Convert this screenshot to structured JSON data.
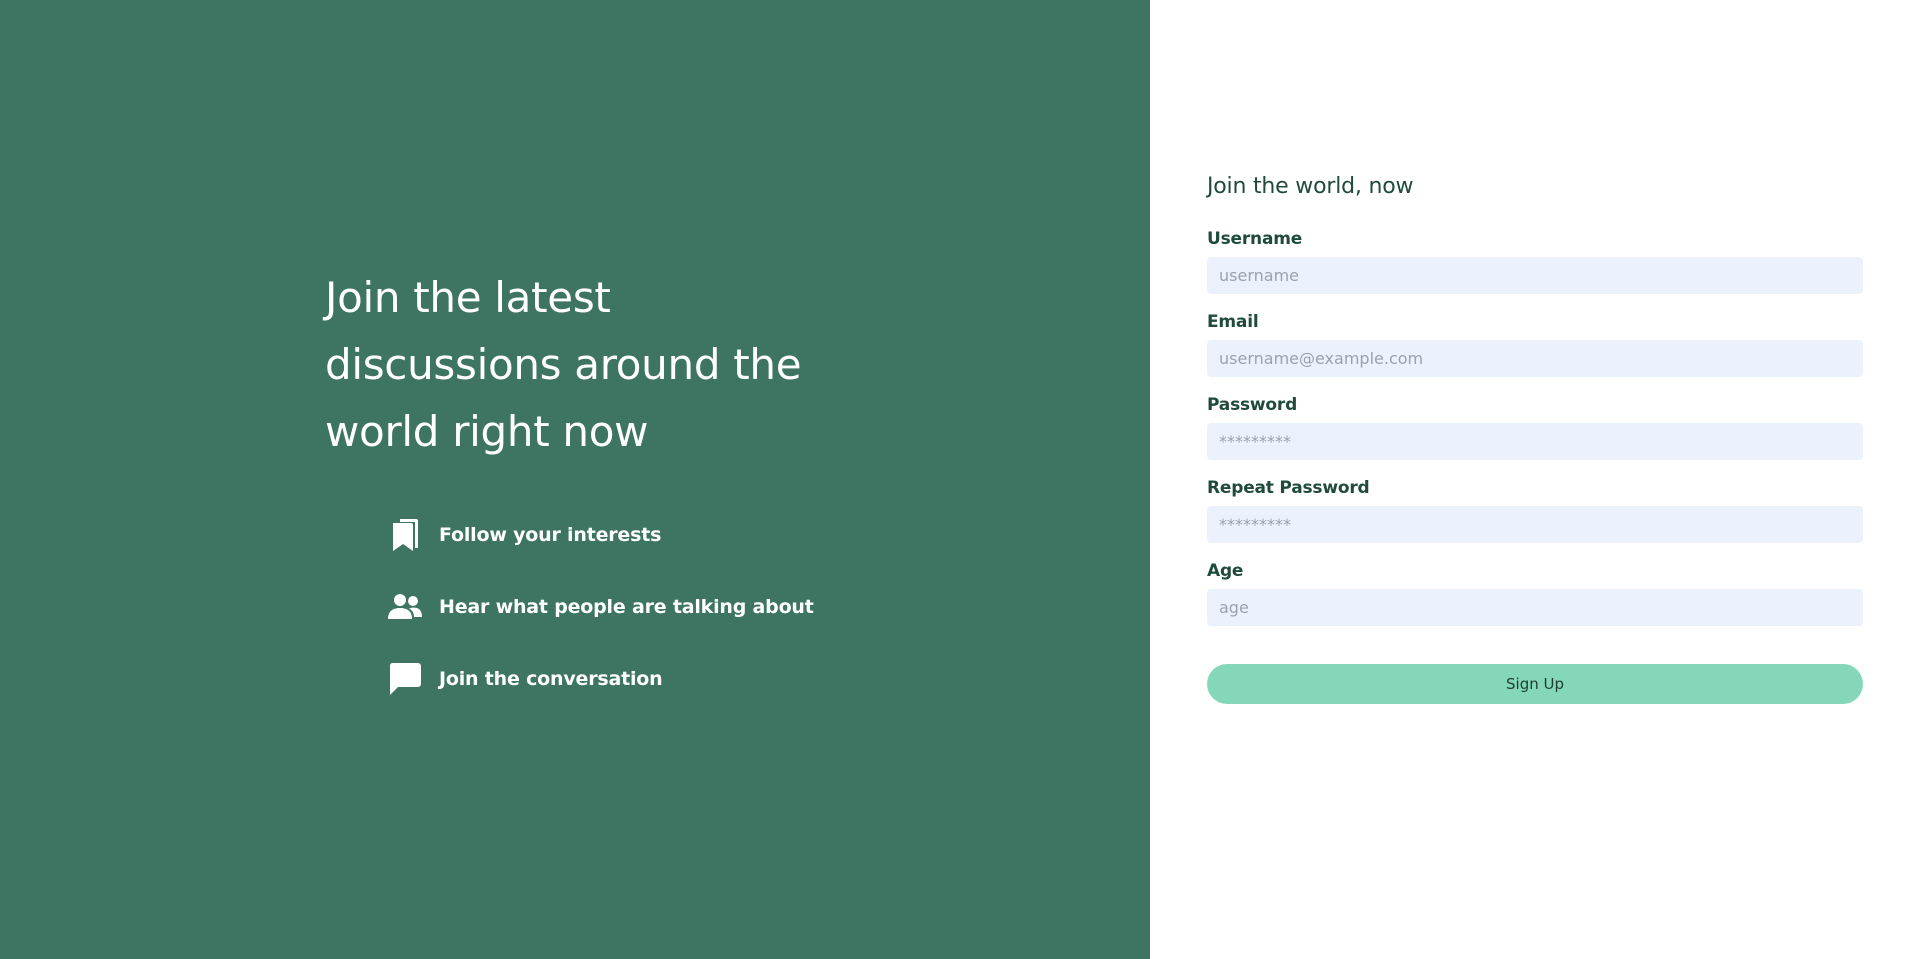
{
  "hero": {
    "title": "Join the latest discussions around the world right now",
    "features": [
      {
        "icon": "bookmark-icon",
        "label": "Follow your interests"
      },
      {
        "icon": "people-icon",
        "label": "Hear what people are talking about"
      },
      {
        "icon": "chat-bubble-icon",
        "label": "Join the conversation"
      }
    ]
  },
  "form": {
    "title": "Join the world, now",
    "fields": {
      "username": {
        "label": "Username",
        "placeholder": "username",
        "value": ""
      },
      "email": {
        "label": "Email",
        "placeholder": "username@example.com",
        "value": ""
      },
      "password": {
        "label": "Password",
        "placeholder": "*********",
        "value": ""
      },
      "repeat_password": {
        "label": "Repeat Password",
        "placeholder": "*********",
        "value": ""
      },
      "age": {
        "label": "Age",
        "placeholder": "age",
        "value": ""
      }
    },
    "submit_label": "Sign Up"
  },
  "colors": {
    "left_panel_bg": "#3e7462",
    "input_bg": "#ebf2fd",
    "button_bg": "#84d8b9",
    "heading_text": "#1f4a3c"
  }
}
